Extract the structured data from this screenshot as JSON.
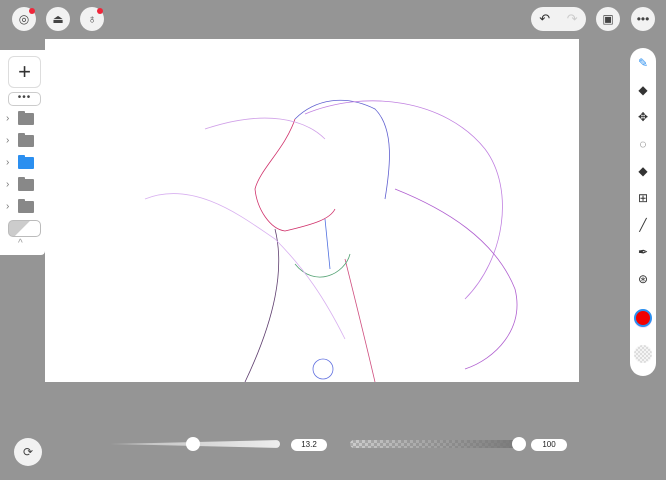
{
  "top_left": [
    {
      "name": "gallery",
      "dot": true
    },
    {
      "name": "import",
      "dot": false
    },
    {
      "name": "tips",
      "dot": true
    }
  ],
  "layers_panel": {
    "add": "+",
    "more": "•••",
    "layers": [
      {
        "selected": false
      },
      {
        "selected": false
      },
      {
        "selected": true
      },
      {
        "selected": false
      },
      {
        "selected": false
      }
    ],
    "collapse": "^"
  },
  "top_right": {
    "undo": "↶",
    "redo": "↷",
    "reference": "▣",
    "menu": "•••"
  },
  "tools": [
    {
      "name": "pen",
      "glyph": "✎"
    },
    {
      "name": "eraser",
      "glyph": "◆"
    },
    {
      "name": "move",
      "glyph": "✥"
    },
    {
      "name": "lasso",
      "glyph": "◌"
    },
    {
      "name": "fill",
      "glyph": "◆"
    },
    {
      "name": "transform",
      "glyph": "⊞"
    },
    {
      "name": "line",
      "glyph": "╱"
    },
    {
      "name": "eyedropper",
      "glyph": "✒"
    },
    {
      "name": "symmetry",
      "glyph": "⊛"
    }
  ],
  "colors": {
    "primary": "#f20000",
    "secondary": "#f5ddf8",
    "accent": "#2b8ff0"
  },
  "brush_size": {
    "value": "13.2",
    "fraction": 0.49
  },
  "opacity": {
    "value": "100",
    "fraction": 0.97
  },
  "rotate": "⟳"
}
